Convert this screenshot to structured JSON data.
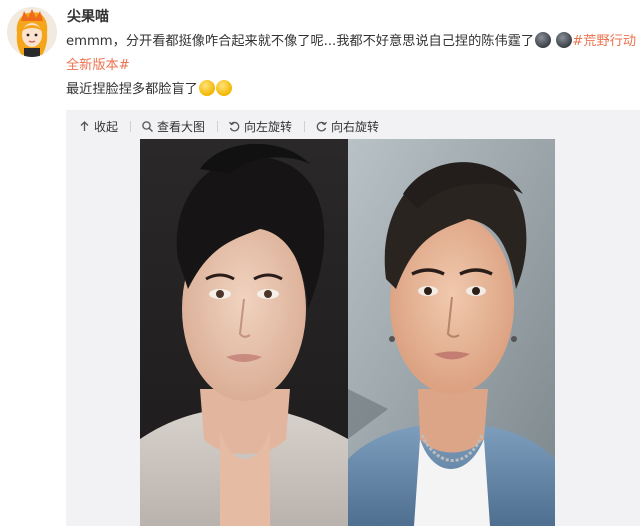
{
  "post": {
    "username": "尖果喵",
    "text_line1": "emmm，分开看都挺像咋合起来就不像了呢...我都不好意思说自己捏的陈伟霆了",
    "topic_part1": "#荒野行动",
    "topic_part2": "全新版本#",
    "text_line3": "最近捏脸捏多都脸盲了"
  },
  "toolbar": {
    "collapse": "收起",
    "view_large": "查看大图",
    "rotate_left": "向左旋转",
    "rotate_right": "向右旋转"
  },
  "colors": {
    "link": "#eb7350",
    "media_bg": "#f2f2f5"
  },
  "icons": {
    "collapse": "arrow-up-icon",
    "view_large": "magnifier-icon",
    "rotate_left": "rotate-left-icon",
    "rotate_right": "rotate-right-icon"
  }
}
